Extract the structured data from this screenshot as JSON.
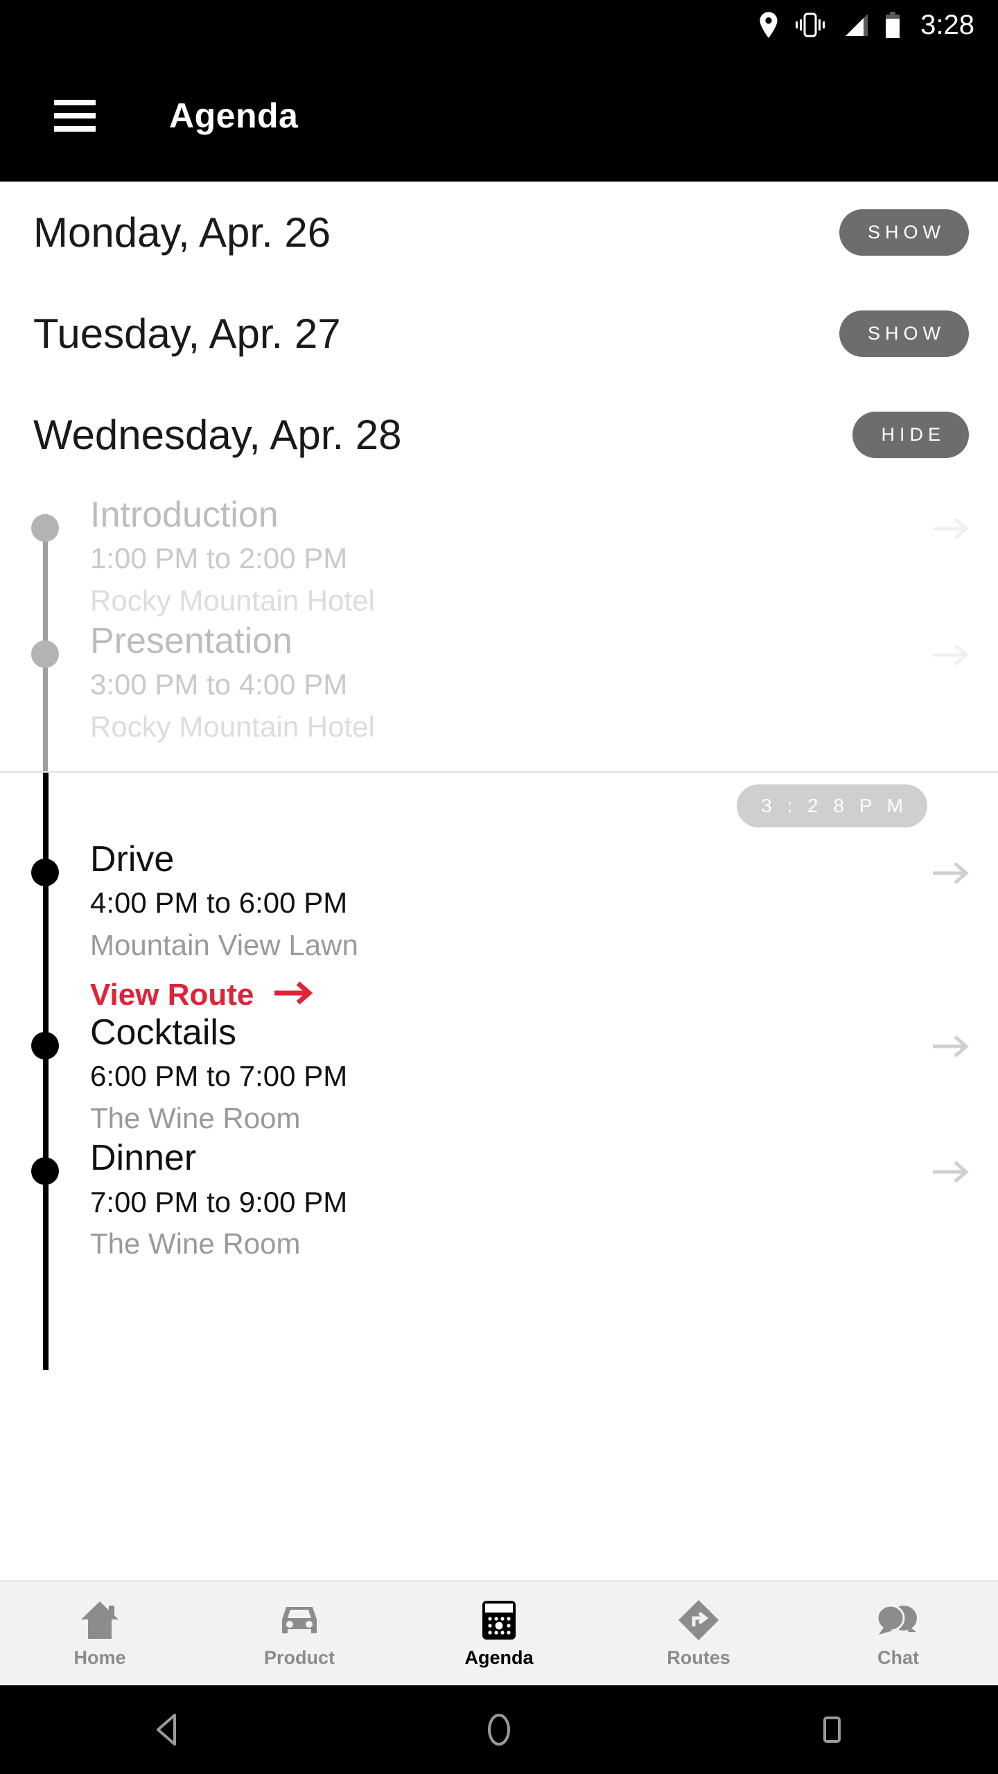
{
  "status_bar": {
    "time": "3:28",
    "icons": [
      "location-pin-icon",
      "vibrate-icon",
      "signal-icon",
      "battery-icon"
    ]
  },
  "app_bar": {
    "menu_icon": "hamburger-menu-icon",
    "title": "Agenda"
  },
  "dates": [
    {
      "label": "Monday, Apr. 26",
      "toggle": "SHOW",
      "expanded": false
    },
    {
      "label": "Tuesday, Apr. 27",
      "toggle": "SHOW",
      "expanded": false
    },
    {
      "label": "Wednesday, Apr. 28",
      "toggle": "HIDE",
      "expanded": true
    }
  ],
  "now_badge": {
    "time": "3 : 2 8   P M"
  },
  "events": [
    {
      "title": "Introduction",
      "time": "1:00 PM to 2:00 PM",
      "place": "Rocky Mountain Hotel",
      "state": "past"
    },
    {
      "title": "Presentation",
      "time": "3:00 PM to 4:00 PM",
      "place": "Rocky Mountain Hotel",
      "state": "past"
    },
    {
      "title": "Drive",
      "time": "4:00 PM to 6:00 PM",
      "place": "Mountain View Lawn",
      "state": "active",
      "route_label": "View Route"
    },
    {
      "title": "Cocktails",
      "time": "6:00 PM to 7:00 PM",
      "place": "The Wine Room",
      "state": "active"
    },
    {
      "title": "Dinner",
      "time": "7:00 PM to 9:00 PM",
      "place": "The Wine Room",
      "state": "active"
    }
  ],
  "tabs": [
    {
      "label": "Home",
      "icon": "home-icon",
      "active": false
    },
    {
      "label": "Product",
      "icon": "car-icon",
      "active": false
    },
    {
      "label": "Agenda",
      "icon": "calendar-icon",
      "active": true
    },
    {
      "label": "Routes",
      "icon": "route-icon",
      "active": false
    },
    {
      "label": "Chat",
      "icon": "chat-icon",
      "active": false
    }
  ],
  "system_nav": {
    "back": "back-triangle-icon",
    "home": "home-circle-icon",
    "recents": "recents-square-icon"
  },
  "colors": {
    "accent_red": "#e02338",
    "pill_gray": "#6d6d6d",
    "now_pill_gray": "#cfcfcf",
    "tabbar_bg": "#f2f2f2",
    "muted_text": "#9a9a9a"
  }
}
